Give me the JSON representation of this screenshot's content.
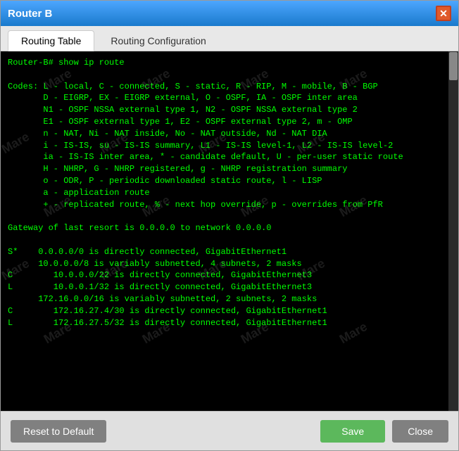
{
  "window": {
    "title": "Router B"
  },
  "tabs": [
    {
      "id": "routing-table",
      "label": "Routing Table",
      "active": true
    },
    {
      "id": "routing-config",
      "label": "Routing Configuration",
      "active": false
    }
  ],
  "terminal": {
    "content": "Router-B# show ip route\n\nCodes: L - local, C - connected, S - static, R - RIP, M - mobile, B - BGP\n       D - EIGRP, EX - EIGRP external, O - OSPF, IA - OSPF inter area\n       N1 - OSPF NSSA external type 1, N2 - OSPF NSSA external type 2\n       E1 - OSPF external type 1, E2 - OSPF external type 2, m - OMP\n       n - NAT, Ni - NAT inside, No - NAT outside, Nd - NAT DIA\n       i - IS-IS, su - IS-IS summary, L1 - IS-IS level-1, L2 - IS-IS level-2\n       ia - IS-IS inter area, * - candidate default, U - per-user static route\n       H - NHRP, G - NHRP registered, g - NHRP registration summary\n       o - ODR, P - periodic downloaded static route, l - LISP\n       a - application route\n       + - replicated route, % - next hop override, p - overrides from PfR\n\nGateway of last resort is 0.0.0.0 to network 0.0.0.0\n\nS*    0.0.0.0/0 is directly connected, GigabitEthernet1\n      10.0.0.0/8 is variably subnetted, 4 subnets, 2 masks\nC        10.0.0.0/22 is directly connected, GigabitEthernet3\nL        10.0.0.1/32 is directly connected, GigabitEthernet3\n      172.16.0.0/16 is variably subnetted, 2 subnets, 2 masks\nC        172.16.27.4/30 is directly connected, GigabitEthernet1\nL        172.16.27.5/32 is directly connected, GigabitEthernet1"
  },
  "buttons": {
    "reset": "Reset to Default",
    "save": "Save",
    "close": "Close"
  },
  "watermark_text": "Mare"
}
